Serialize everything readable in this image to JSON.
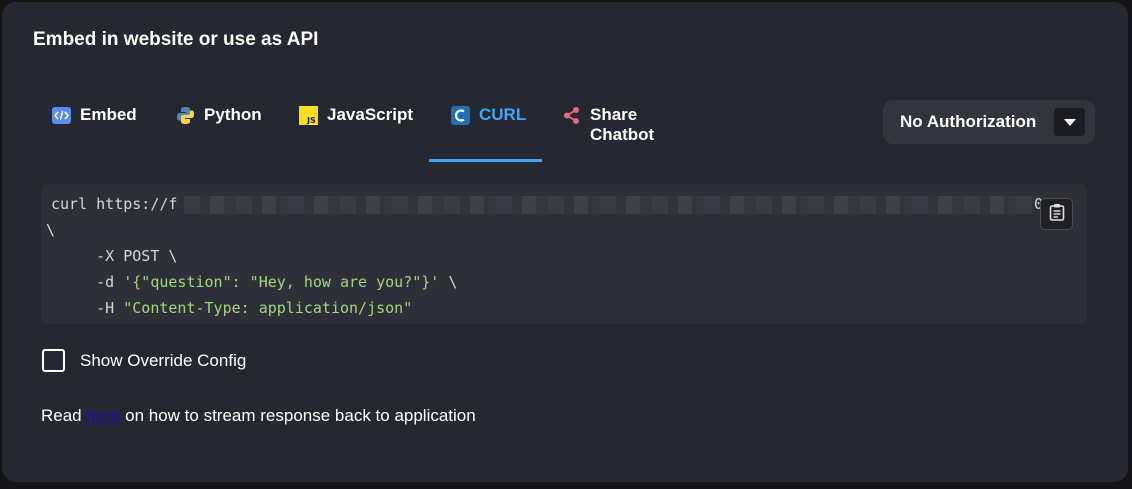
{
  "dialog": {
    "title": "Embed in website or use as API"
  },
  "tabs": [
    {
      "label": "Embed",
      "icon": "embed-code-icon",
      "active": false
    },
    {
      "label": "Python",
      "icon": "python-icon",
      "active": false
    },
    {
      "label": "JavaScript",
      "icon": "javascript-icon",
      "active": false
    },
    {
      "label": "CURL",
      "icon": "curl-icon",
      "active": true
    },
    {
      "label": "Share Chatbot",
      "icon": "share-icon",
      "active": false
    }
  ],
  "auth_select": {
    "value": "No Authorization",
    "icon": "chevron-down-icon"
  },
  "code": {
    "line1": "curl https://f",
    "line1_end": "0",
    "line2": "\\",
    "line3": "     -X POST \\",
    "line4_prefix": "     -d ",
    "line4_string": "'{\"question\": \"Hey, how are you?\"}'",
    "line4_suffix": " \\",
    "line5_prefix": "     -H ",
    "line5_string": "\"Content-Type: application/json\""
  },
  "override": {
    "label": "Show Override Config",
    "checked": false
  },
  "read_note": {
    "prefix": "Read ",
    "link": "here",
    "suffix": " on how to stream response back to application"
  },
  "colors": {
    "accent": "#42a5f5",
    "dialog_bg": "#252830",
    "code_bg": "#2d3038",
    "string": "#a5d67a"
  }
}
